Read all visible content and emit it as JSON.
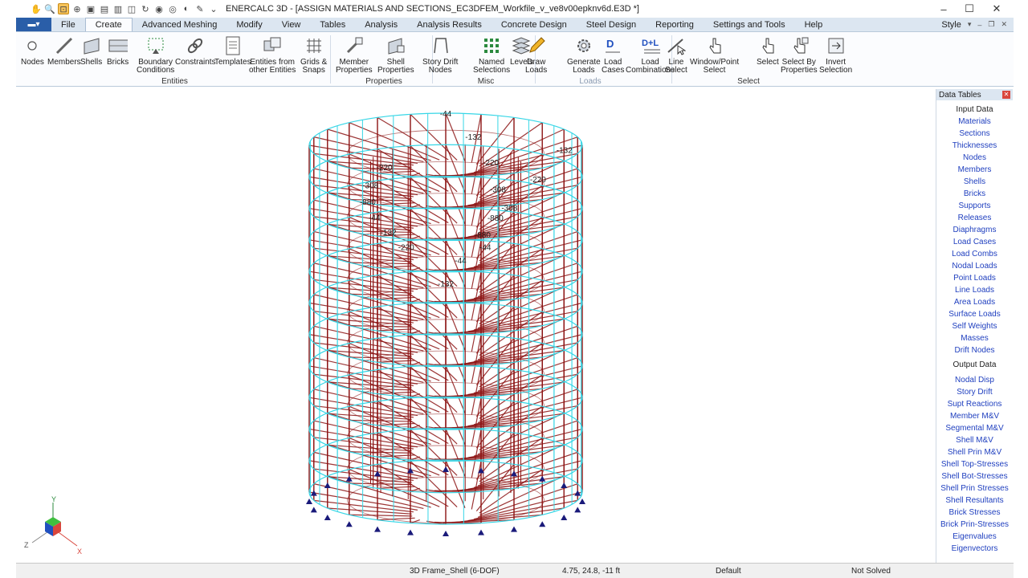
{
  "window": {
    "title": "ENERCALC 3D - [ASSIGN MATERIALS AND SECTIONS_EC3DFEM_Workfile_v_ve8v00epknv6d.E3D *]",
    "min_glyph": "–",
    "max_glyph": "☐",
    "close_glyph": "✕"
  },
  "menu": {
    "tabs": [
      "File",
      "Create",
      "Advanced Meshing",
      "Modify",
      "View",
      "Tables",
      "Analysis",
      "Analysis Results",
      "Concrete Design",
      "Steel Design",
      "Reporting",
      "Settings and Tools",
      "Help"
    ],
    "active_tab": "Create",
    "style_label": "Style"
  },
  "ribbon": {
    "entities": {
      "label": "Entities",
      "nodes": "Nodes",
      "members": "Members",
      "shells": "Shells",
      "bricks": "Bricks",
      "boundary": "Boundary\nConditions",
      "constraints": "Constraints",
      "templates": "Templates",
      "from_other": "Entities from\nother Entities",
      "grids": "Grids &\nSnaps"
    },
    "properties": {
      "label": "Properties",
      "member_props": "Member\nProperties",
      "shell_props": "Shell\nProperties"
    },
    "misc": {
      "label": "Misc",
      "story_drift": "Story Drift\nNodes",
      "named_sel": "Named\nSelections",
      "levels": "Levels"
    },
    "loads": {
      "label": "Loads",
      "draw_loads": "Draw\nLoads",
      "generate_loads": "Generate\nLoads",
      "load_cases": "Load\nCases",
      "load_combos": "Load\nCombinations",
      "dl_icon_text": "D+L",
      "d_icon_text": "D"
    },
    "select": {
      "label": "Select",
      "line_select": "Line\nSelect",
      "window_point": "Window/Point\nSelect",
      "select": "Select",
      "select_by_props": "Select By\nProperties",
      "invert": "Invert\nSelection"
    }
  },
  "model": {
    "labels": [
      "-44",
      "-132",
      "-220",
      "-308",
      "-880",
      "-44",
      "-132",
      "-220",
      "-308",
      "-880",
      "-44",
      "-132",
      "-220",
      "-308",
      "-880",
      "-44",
      "-132",
      "-220"
    ],
    "colors": {
      "rings": "#36d6e6",
      "members": "#8b1212",
      "supports": "#1a1a7a"
    }
  },
  "axis": {
    "x": "X",
    "y": "Y",
    "z": "Z"
  },
  "data_tables": {
    "title": "Data Tables",
    "input_label": "Input Data",
    "input_items": [
      "Materials",
      "Sections",
      "Thicknesses",
      "Nodes",
      "Members",
      "Shells",
      "Bricks",
      "Supports",
      "Releases",
      "Diaphragms",
      "Load Cases",
      "Load Combs",
      "Nodal Loads",
      "Point Loads",
      "Line Loads",
      "Area Loads",
      "Surface Loads",
      "Self Weights",
      "Masses",
      "Drift Nodes"
    ],
    "output_label": "Output Data",
    "output_items": [
      "Nodal Disp",
      "Story Drift",
      "Supt Reactions",
      "Member M&V",
      "Segmental M&V",
      "Shell M&V",
      "Shell Prin M&V",
      "Shell Top-Stresses",
      "Shell Bot-Stresses",
      "Shell Prin Stresses",
      "Shell Resultants",
      "Brick Stresses",
      "Brick Prin-Stresses",
      "Eigenvalues",
      "Eigenvectors"
    ]
  },
  "status": {
    "frame_type": "3D Frame_Shell (6-DOF)",
    "coords": "4.75, 24.8, -11 ft",
    "view": "Default",
    "solve_state": "Not Solved"
  }
}
